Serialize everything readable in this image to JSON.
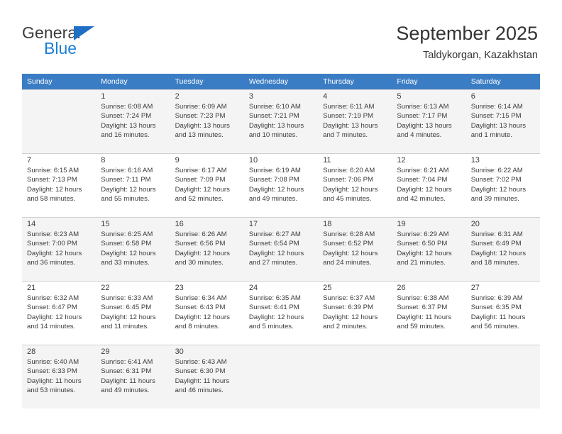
{
  "brand": {
    "name_top": "General",
    "name_bottom": "Blue",
    "triangle_color": "#1f6fc4",
    "blue_text_color": "#1a7fd4"
  },
  "header": {
    "title": "September 2025",
    "subtitle": "Taldykorgan, Kazakhstan",
    "header_bg": "#3b7dc4",
    "alt_row_bg": "#f4f4f4"
  },
  "weekdays": [
    "Sunday",
    "Monday",
    "Tuesday",
    "Wednesday",
    "Thursday",
    "Friday",
    "Saturday"
  ],
  "weeks": [
    [
      {
        "day": "",
        "sunrise": "",
        "sunset": "",
        "daylight_a": "",
        "daylight_b": ""
      },
      {
        "day": "1",
        "sunrise": "Sunrise: 6:08 AM",
        "sunset": "Sunset: 7:24 PM",
        "daylight_a": "Daylight: 13 hours",
        "daylight_b": "and 16 minutes."
      },
      {
        "day": "2",
        "sunrise": "Sunrise: 6:09 AM",
        "sunset": "Sunset: 7:23 PM",
        "daylight_a": "Daylight: 13 hours",
        "daylight_b": "and 13 minutes."
      },
      {
        "day": "3",
        "sunrise": "Sunrise: 6:10 AM",
        "sunset": "Sunset: 7:21 PM",
        "daylight_a": "Daylight: 13 hours",
        "daylight_b": "and 10 minutes."
      },
      {
        "day": "4",
        "sunrise": "Sunrise: 6:11 AM",
        "sunset": "Sunset: 7:19 PM",
        "daylight_a": "Daylight: 13 hours",
        "daylight_b": "and 7 minutes."
      },
      {
        "day": "5",
        "sunrise": "Sunrise: 6:13 AM",
        "sunset": "Sunset: 7:17 PM",
        "daylight_a": "Daylight: 13 hours",
        "daylight_b": "and 4 minutes."
      },
      {
        "day": "6",
        "sunrise": "Sunrise: 6:14 AM",
        "sunset": "Sunset: 7:15 PM",
        "daylight_a": "Daylight: 13 hours",
        "daylight_b": "and 1 minute."
      }
    ],
    [
      {
        "day": "7",
        "sunrise": "Sunrise: 6:15 AM",
        "sunset": "Sunset: 7:13 PM",
        "daylight_a": "Daylight: 12 hours",
        "daylight_b": "and 58 minutes."
      },
      {
        "day": "8",
        "sunrise": "Sunrise: 6:16 AM",
        "sunset": "Sunset: 7:11 PM",
        "daylight_a": "Daylight: 12 hours",
        "daylight_b": "and 55 minutes."
      },
      {
        "day": "9",
        "sunrise": "Sunrise: 6:17 AM",
        "sunset": "Sunset: 7:09 PM",
        "daylight_a": "Daylight: 12 hours",
        "daylight_b": "and 52 minutes."
      },
      {
        "day": "10",
        "sunrise": "Sunrise: 6:19 AM",
        "sunset": "Sunset: 7:08 PM",
        "daylight_a": "Daylight: 12 hours",
        "daylight_b": "and 49 minutes."
      },
      {
        "day": "11",
        "sunrise": "Sunrise: 6:20 AM",
        "sunset": "Sunset: 7:06 PM",
        "daylight_a": "Daylight: 12 hours",
        "daylight_b": "and 45 minutes."
      },
      {
        "day": "12",
        "sunrise": "Sunrise: 6:21 AM",
        "sunset": "Sunset: 7:04 PM",
        "daylight_a": "Daylight: 12 hours",
        "daylight_b": "and 42 minutes."
      },
      {
        "day": "13",
        "sunrise": "Sunrise: 6:22 AM",
        "sunset": "Sunset: 7:02 PM",
        "daylight_a": "Daylight: 12 hours",
        "daylight_b": "and 39 minutes."
      }
    ],
    [
      {
        "day": "14",
        "sunrise": "Sunrise: 6:23 AM",
        "sunset": "Sunset: 7:00 PM",
        "daylight_a": "Daylight: 12 hours",
        "daylight_b": "and 36 minutes."
      },
      {
        "day": "15",
        "sunrise": "Sunrise: 6:25 AM",
        "sunset": "Sunset: 6:58 PM",
        "daylight_a": "Daylight: 12 hours",
        "daylight_b": "and 33 minutes."
      },
      {
        "day": "16",
        "sunrise": "Sunrise: 6:26 AM",
        "sunset": "Sunset: 6:56 PM",
        "daylight_a": "Daylight: 12 hours",
        "daylight_b": "and 30 minutes."
      },
      {
        "day": "17",
        "sunrise": "Sunrise: 6:27 AM",
        "sunset": "Sunset: 6:54 PM",
        "daylight_a": "Daylight: 12 hours",
        "daylight_b": "and 27 minutes."
      },
      {
        "day": "18",
        "sunrise": "Sunrise: 6:28 AM",
        "sunset": "Sunset: 6:52 PM",
        "daylight_a": "Daylight: 12 hours",
        "daylight_b": "and 24 minutes."
      },
      {
        "day": "19",
        "sunrise": "Sunrise: 6:29 AM",
        "sunset": "Sunset: 6:50 PM",
        "daylight_a": "Daylight: 12 hours",
        "daylight_b": "and 21 minutes."
      },
      {
        "day": "20",
        "sunrise": "Sunrise: 6:31 AM",
        "sunset": "Sunset: 6:49 PM",
        "daylight_a": "Daylight: 12 hours",
        "daylight_b": "and 18 minutes."
      }
    ],
    [
      {
        "day": "21",
        "sunrise": "Sunrise: 6:32 AM",
        "sunset": "Sunset: 6:47 PM",
        "daylight_a": "Daylight: 12 hours",
        "daylight_b": "and 14 minutes."
      },
      {
        "day": "22",
        "sunrise": "Sunrise: 6:33 AM",
        "sunset": "Sunset: 6:45 PM",
        "daylight_a": "Daylight: 12 hours",
        "daylight_b": "and 11 minutes."
      },
      {
        "day": "23",
        "sunrise": "Sunrise: 6:34 AM",
        "sunset": "Sunset: 6:43 PM",
        "daylight_a": "Daylight: 12 hours",
        "daylight_b": "and 8 minutes."
      },
      {
        "day": "24",
        "sunrise": "Sunrise: 6:35 AM",
        "sunset": "Sunset: 6:41 PM",
        "daylight_a": "Daylight: 12 hours",
        "daylight_b": "and 5 minutes."
      },
      {
        "day": "25",
        "sunrise": "Sunrise: 6:37 AM",
        "sunset": "Sunset: 6:39 PM",
        "daylight_a": "Daylight: 12 hours",
        "daylight_b": "and 2 minutes."
      },
      {
        "day": "26",
        "sunrise": "Sunrise: 6:38 AM",
        "sunset": "Sunset: 6:37 PM",
        "daylight_a": "Daylight: 11 hours",
        "daylight_b": "and 59 minutes."
      },
      {
        "day": "27",
        "sunrise": "Sunrise: 6:39 AM",
        "sunset": "Sunset: 6:35 PM",
        "daylight_a": "Daylight: 11 hours",
        "daylight_b": "and 56 minutes."
      }
    ],
    [
      {
        "day": "28",
        "sunrise": "Sunrise: 6:40 AM",
        "sunset": "Sunset: 6:33 PM",
        "daylight_a": "Daylight: 11 hours",
        "daylight_b": "and 53 minutes."
      },
      {
        "day": "29",
        "sunrise": "Sunrise: 6:41 AM",
        "sunset": "Sunset: 6:31 PM",
        "daylight_a": "Daylight: 11 hours",
        "daylight_b": "and 49 minutes."
      },
      {
        "day": "30",
        "sunrise": "Sunrise: 6:43 AM",
        "sunset": "Sunset: 6:30 PM",
        "daylight_a": "Daylight: 11 hours",
        "daylight_b": "and 46 minutes."
      },
      {
        "day": "",
        "sunrise": "",
        "sunset": "",
        "daylight_a": "",
        "daylight_b": ""
      },
      {
        "day": "",
        "sunrise": "",
        "sunset": "",
        "daylight_a": "",
        "daylight_b": ""
      },
      {
        "day": "",
        "sunrise": "",
        "sunset": "",
        "daylight_a": "",
        "daylight_b": ""
      },
      {
        "day": "",
        "sunrise": "",
        "sunset": "",
        "daylight_a": "",
        "daylight_b": ""
      }
    ]
  ]
}
